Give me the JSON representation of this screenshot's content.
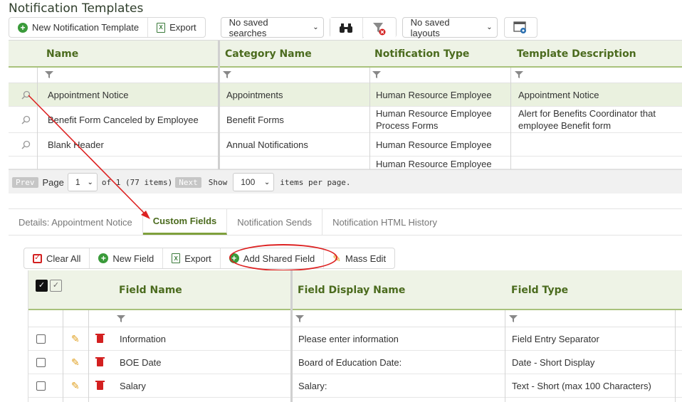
{
  "page": {
    "title": "Notification Templates"
  },
  "toolbar": {
    "new_label": "New Notification Template",
    "export_label": "Export",
    "saved_searches": "No saved searches",
    "saved_layouts": "No saved layouts"
  },
  "grid1": {
    "columns": [
      "Name",
      "Category Name",
      "Notification Type",
      "Template Description"
    ],
    "rows": [
      {
        "name": "Appointment Notice",
        "category": "Appointments",
        "type": "Human Resource Employee",
        "description": "Appointment Notice"
      },
      {
        "name": "Benefit Form Canceled by Employee",
        "category": "Benefit Forms",
        "type": "Human Resource Employee Process Forms",
        "description": "Alert for Benefits Coordinator that employee Benefit form"
      },
      {
        "name": "Blank Header",
        "category": "Annual Notifications",
        "type": "Human Resource Employee",
        "description": ""
      },
      {
        "name": "",
        "category": "",
        "type": "Human Resource Employee",
        "description": ""
      }
    ],
    "pager": {
      "prev": "Prev",
      "page_label": "Page",
      "page_value": "1",
      "of_text": "of 1 (77 items)",
      "next": "Next",
      "show_label": "Show",
      "per_page_value": "100",
      "per_page_text": "items per page."
    }
  },
  "tabs": [
    {
      "label": "Details: Appointment Notice",
      "active": false
    },
    {
      "label": "Custom Fields",
      "active": true
    },
    {
      "label": "Notification Sends",
      "active": false
    },
    {
      "label": "Notification HTML History",
      "active": false
    }
  ],
  "toolbar2": {
    "clear_all": "Clear All",
    "new_field": "New Field",
    "export": "Export",
    "add_shared": "Add Shared Field",
    "mass_edit": "Mass Edit"
  },
  "grid2": {
    "columns": [
      "Field Name",
      "Field Display Name",
      "Field Type"
    ],
    "rows": [
      {
        "name": "Information",
        "display": "Please enter information",
        "type": "Field Entry Separator"
      },
      {
        "name": "BOE Date",
        "display": "Board of Education Date:",
        "type": "Date - Short Display"
      },
      {
        "name": "Salary",
        "display": "Salary:",
        "type": "Text - Short (max 100 Characters)"
      }
    ]
  },
  "colors": {
    "accent": "#4b6b1e",
    "header_bg": "#eef3e6",
    "annotation": "#dd2222"
  }
}
